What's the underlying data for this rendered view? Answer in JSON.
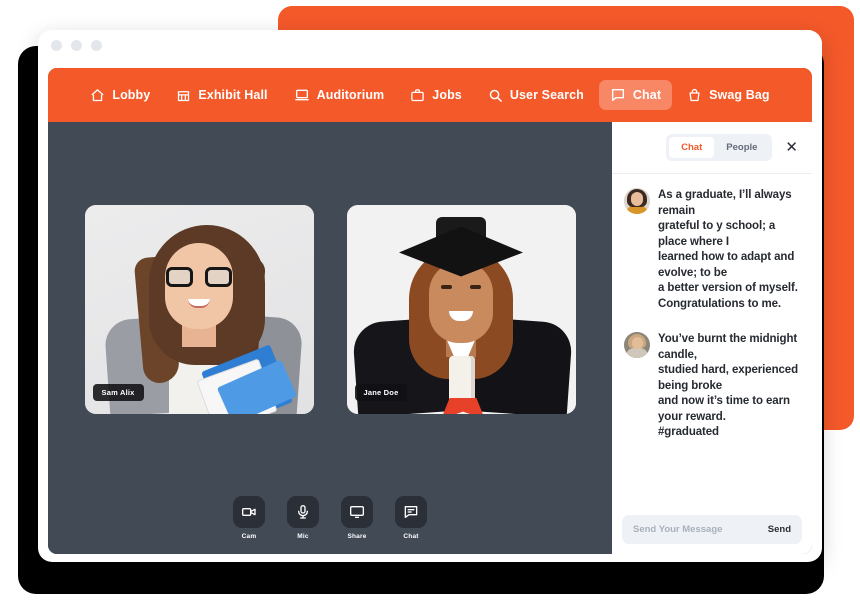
{
  "window": {
    "traffic_dots": [
      "dot-1",
      "dot-2",
      "dot-3"
    ]
  },
  "navbar": {
    "items": [
      {
        "label": "Lobby",
        "icon": "home-icon",
        "active": false
      },
      {
        "label": "Exhibit Hall",
        "icon": "store-icon",
        "active": false
      },
      {
        "label": "Auditorium",
        "icon": "laptop-icon",
        "active": false
      },
      {
        "label": "Jobs",
        "icon": "briefcase-icon",
        "active": false
      },
      {
        "label": "User Search",
        "icon": "search-icon",
        "active": false
      },
      {
        "label": "Chat",
        "icon": "chat-bubble-icon",
        "active": true
      },
      {
        "label": "Swag Bag",
        "icon": "shopping-bag-icon",
        "active": false
      }
    ]
  },
  "stage": {
    "tiles": [
      {
        "name": "Sam Alix"
      },
      {
        "name": "Jane Doe"
      }
    ]
  },
  "controls": [
    {
      "label": "Cam",
      "icon": "video-camera-icon"
    },
    {
      "label": "Mic",
      "icon": "microphone-icon"
    },
    {
      "label": "Share",
      "icon": "monitor-screen-icon"
    },
    {
      "label": "Chat",
      "icon": "chat-bubble-icon"
    }
  ],
  "chat": {
    "tabs": [
      {
        "label": "Chat",
        "active": true
      },
      {
        "label": "People",
        "active": false
      }
    ],
    "close_label": "✕",
    "messages": [
      {
        "avatar": "avatar-graduate-woman",
        "text": "As a graduate, I’ll always remain\ngrateful to y school; a place where I\nlearned how to adapt and evolve; to be\na better version of myself.\nCongratulations to me."
      },
      {
        "avatar": "avatar-second-user",
        "text": "You’ve burnt the midnight candle,\nstudied hard, experienced being broke\nand now it’s time to earn your reward.\n#graduated"
      }
    ],
    "input": {
      "value": "",
      "placeholder": "Send Your Message",
      "send_label": "Send"
    }
  },
  "colors": {
    "brand_orange": "#f4592a",
    "nav_active": "rgba(255,255,255,.28)",
    "app_dark": "#424a56",
    "control_dark": "#2a2f38",
    "panel_bg": "#ffffff"
  }
}
